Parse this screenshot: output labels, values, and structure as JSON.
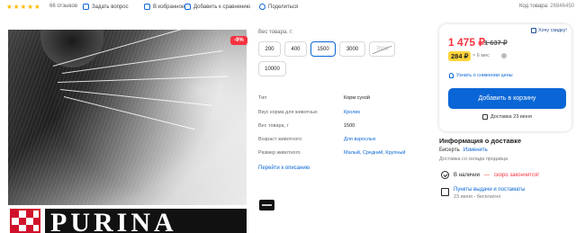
{
  "topbar": {
    "rating_stars": 5,
    "reviews": "66 отзывов",
    "ask_question": "Задать вопрос",
    "favorites": "В избранное",
    "compare": "Добавить к сравнению",
    "share": "Поделиться",
    "code_label": "Код товара:",
    "code_value": "26846450"
  },
  "photo": {
    "discount": "-9%",
    "brand": "PURINA"
  },
  "weight": {
    "label": "Вес товара, г:",
    "options": [
      {
        "label": "200",
        "state": "normal"
      },
      {
        "label": "400",
        "state": "normal"
      },
      {
        "label": "1500",
        "state": "selected"
      },
      {
        "label": "3000",
        "state": "normal"
      },
      {
        "label": "7000",
        "state": "unavailable"
      },
      {
        "label": "10000",
        "state": "normal"
      }
    ]
  },
  "specs": [
    {
      "key": "Тип",
      "value": "Корм сухой",
      "link": false
    },
    {
      "key": "Вкус корма для животных",
      "value": "Кролик",
      "link": true
    },
    {
      "key": "Вес товара, г",
      "value": "1500",
      "link": false
    },
    {
      "key": "Возраст животного",
      "value": "Для взрослых",
      "link": true
    },
    {
      "key": "Размер животного",
      "value": "Малый, Средний, Крупный",
      "link": true
    }
  ],
  "description_link": "Перейти к описанию",
  "buy": {
    "price": "1 475 ₽",
    "old_price": "1 637 ₽",
    "want_discount": "Хочу скидку!",
    "installment": "284 ₽",
    "installment_term": "× 6 мес",
    "notify_price": "Узнать о снижении цены",
    "cart_button": "Добавить в корзину",
    "cart_delivery": "Доставка 23 июня"
  },
  "delivery": {
    "title": "Информация о доставке",
    "city": "Бисерть",
    "change": "Изменить",
    "warehouse": "Доставка со склада продавца",
    "in_stock": "В наличии",
    "in_stock_sep": "—",
    "ending": "скоро закончится!",
    "pickup_title": "Пункты выдачи и постаматы",
    "pickup_date": "23 июня - бесплатно"
  },
  "colors": {
    "accent": "#0a66d6",
    "price_red": "#f5333f",
    "installment_yellow": "#ffd43a",
    "star": "#ffb800"
  }
}
